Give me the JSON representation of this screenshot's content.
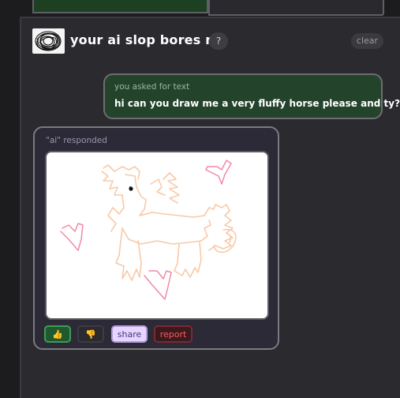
{
  "header": {
    "title": "your ai slop bores me",
    "help_label": "?",
    "clear_label": "clear"
  },
  "user_message": {
    "label": "you asked for text",
    "text": "hi can you draw me a very fluffy horse please and ty?"
  },
  "ai_response": {
    "label": "\"ai\" responded",
    "drawing": "fluffy-horse-sketch-with-hearts"
  },
  "actions": {
    "thumbs_up": "👍",
    "thumbs_down": "👎",
    "share": "share",
    "report": "report"
  },
  "colors": {
    "horse_stroke": "#f8c9a8",
    "heart_stroke": "#f08aa6",
    "user_bubble": "#24432b",
    "ai_card": "#2d2a38"
  }
}
